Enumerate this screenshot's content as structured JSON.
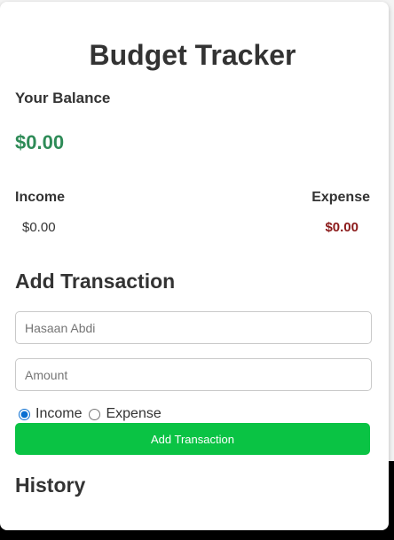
{
  "app": {
    "title": "Budget Tracker"
  },
  "balance": {
    "label": "Your Balance",
    "value": "$0.00",
    "color": "#2e8b57"
  },
  "summary": {
    "income_label": "Income",
    "income_value": "$0.00",
    "expense_label": "Expense",
    "expense_value": "$0.00",
    "expense_color": "#8b1a1a"
  },
  "add_transaction": {
    "heading": "Add Transaction",
    "name_placeholder": "Hasaan Abdi",
    "amount_placeholder": "Amount",
    "type_options": [
      "Income",
      "Expense"
    ],
    "selected_type": "Income",
    "button_label": "Add Transaction",
    "button_color": "#0ac344"
  },
  "history": {
    "heading": "History"
  }
}
